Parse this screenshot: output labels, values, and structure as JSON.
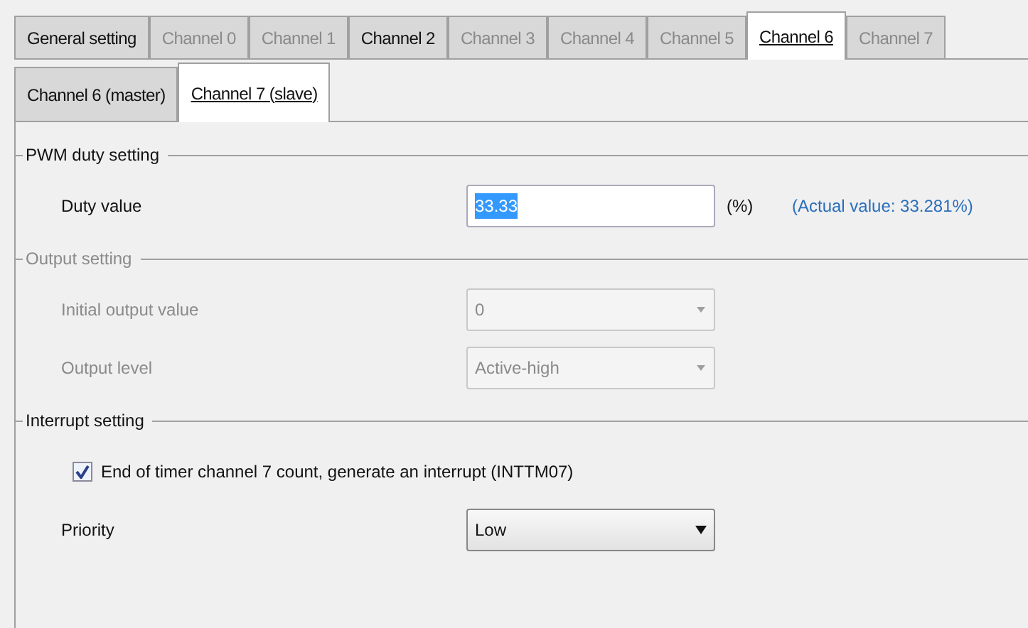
{
  "tabs": [
    {
      "label": "General setting",
      "selected": false,
      "disabled": false
    },
    {
      "label": "Channel 0",
      "selected": false,
      "disabled": true
    },
    {
      "label": "Channel 1",
      "selected": false,
      "disabled": true
    },
    {
      "label": "Channel 2",
      "selected": false,
      "disabled": false
    },
    {
      "label": "Channel 3",
      "selected": false,
      "disabled": true
    },
    {
      "label": "Channel 4",
      "selected": false,
      "disabled": true
    },
    {
      "label": "Channel 5",
      "selected": false,
      "disabled": true
    },
    {
      "label": "Channel 6",
      "selected": true,
      "disabled": false
    },
    {
      "label": "Channel 7",
      "selected": false,
      "disabled": true
    }
  ],
  "subtabs": [
    {
      "label": "Channel 6 (master)",
      "selected": false
    },
    {
      "label": "Channel 7 (slave)",
      "selected": true
    }
  ],
  "sections": [
    {
      "title": "PWM duty setting",
      "disabled": false,
      "rows": [
        {
          "kind": "input",
          "label": "Duty value",
          "value": "33.33",
          "highlighted": true,
          "unit": "(%)",
          "note": "(Actual value: 33.281%)"
        }
      ]
    },
    {
      "title": "Output setting",
      "disabled": true,
      "rows": [
        {
          "kind": "select",
          "label": "Initial output value",
          "value": "0"
        },
        {
          "kind": "select",
          "label": "Output level",
          "value": "Active-high"
        }
      ]
    },
    {
      "title": "Interrupt setting",
      "disabled": false,
      "rows": [
        {
          "kind": "checkbox",
          "label": "End of timer channel 7 count, generate an interrupt (INTTM07)",
          "checked": true
        },
        {
          "kind": "select",
          "label": "Priority",
          "value": "Low"
        }
      ]
    }
  ]
}
